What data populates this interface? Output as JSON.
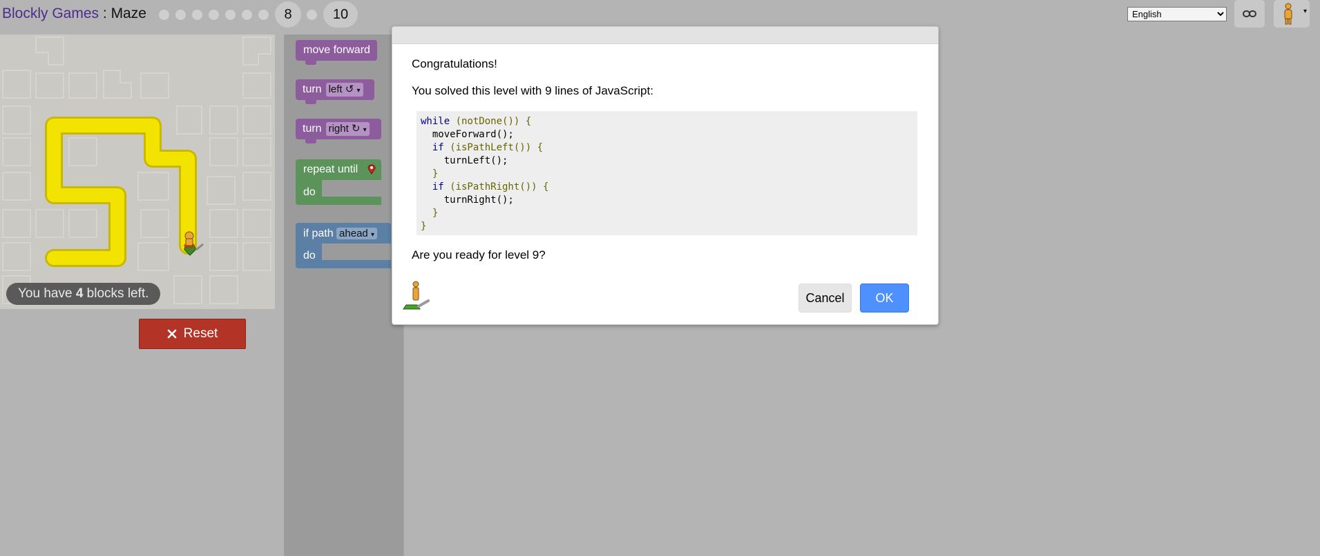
{
  "header": {
    "app_name": "Blockly Games",
    "separator": " : ",
    "game_name": "Maze",
    "levels": [
      "8",
      "10"
    ],
    "language": "English"
  },
  "maze": {
    "blocks_left_prefix": "You have ",
    "blocks_left_count": "4",
    "blocks_left_suffix": " blocks left."
  },
  "controls": {
    "reset_label": "Reset"
  },
  "toolbox": {
    "move_forward": "move forward",
    "turn_label": "turn",
    "turn_left_option": "left ↺",
    "turn_right_option": "right ↻",
    "repeat_until": "repeat until",
    "do_label": "do",
    "if_path": "if path",
    "if_path_option": "ahead"
  },
  "dialog": {
    "congrats": "Congratulations!",
    "solved_text": "You solved this level with 9 lines of JavaScript:",
    "code": {
      "l1a": "while",
      "l1b": " (notDone()) {",
      "l2": "  moveForward();",
      "l3a": "  if",
      "l3b": " (isPathLeft()) {",
      "l4": "    turnLeft();",
      "l5": "  }",
      "l6a": "  if",
      "l6b": " (isPathRight()) {",
      "l7": "    turnRight();",
      "l8": "  }",
      "l9": "}"
    },
    "ready_text": "Are you ready for level 9?",
    "cancel_label": "Cancel",
    "ok_label": "OK"
  }
}
